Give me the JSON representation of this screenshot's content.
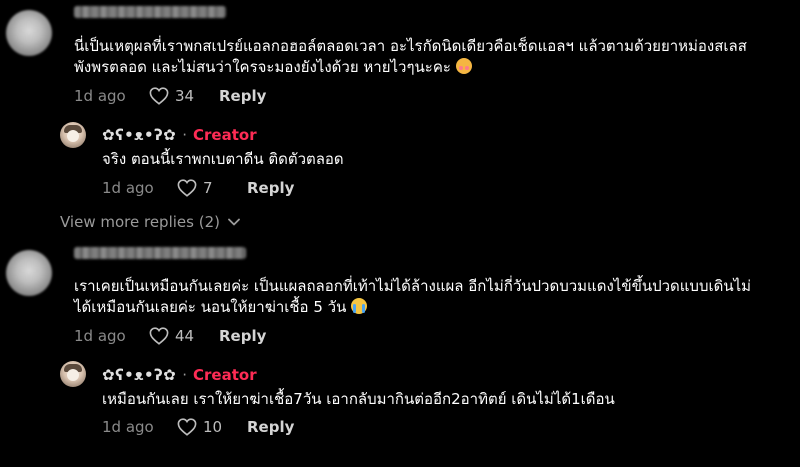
{
  "comments": [
    {
      "text_line1": "นี่เป็นเหตุผลที่เราพกสเปรย์แอลกอฮอล์ตลอดเวลา อะไรกัดนิดเดียวคือเช็ดแอลฯ แล้วตามด้วยยาหม่องสเลส",
      "text_line2": "พังพรตลอด และไม่สนว่าใครจะมองยังไงด้วย หายไวๆนะคะ",
      "emoji": "smiling-face-with-hearts",
      "time": "1d ago",
      "likes": "34",
      "reply_label": "Reply",
      "reply": {
        "author": "✿ʕ•ᴥ•ʔ✿",
        "badge": "Creator",
        "separator": "·",
        "text": "จริง ตอนนี้เราพกเบตาดีน ติดตัวตลอด",
        "time": "1d ago",
        "likes": "7",
        "reply_label": "Reply"
      }
    },
    {
      "text_line1": "เราเคยเป็นเหมือนกันเลยค่ะ เป็นแผลถลอกที่เท้าไม่ได้ล้างแผล อีกไม่กี่วันปวดบวมแดงไข้ขึ้นปวดแบบเดินไม่",
      "text_line2": "ได้เหมือนกันเลยค่ะ นอนให้ยาฆ่าเชื้อ 5 วัน",
      "emoji": "loudly-crying-face",
      "time": "1d ago",
      "likes": "44",
      "reply_label": "Reply",
      "reply": {
        "author": "✿ʕ•ᴥ•ʔ✿",
        "badge": "Creator",
        "separator": "·",
        "text": "เหมือนกันเลย เราให้ยาฆ่าเชื้อ7วัน เอากลับมากินต่ออีก2อาทิตย์ เดินไม่ได้1เดือน",
        "time": "1d ago",
        "likes": "10",
        "reply_label": "Reply"
      }
    }
  ],
  "view_more": "View more replies (2)",
  "colors": {
    "background": "#000000",
    "creator_badge": "#fe2c55",
    "muted": "#8a8a8a"
  }
}
